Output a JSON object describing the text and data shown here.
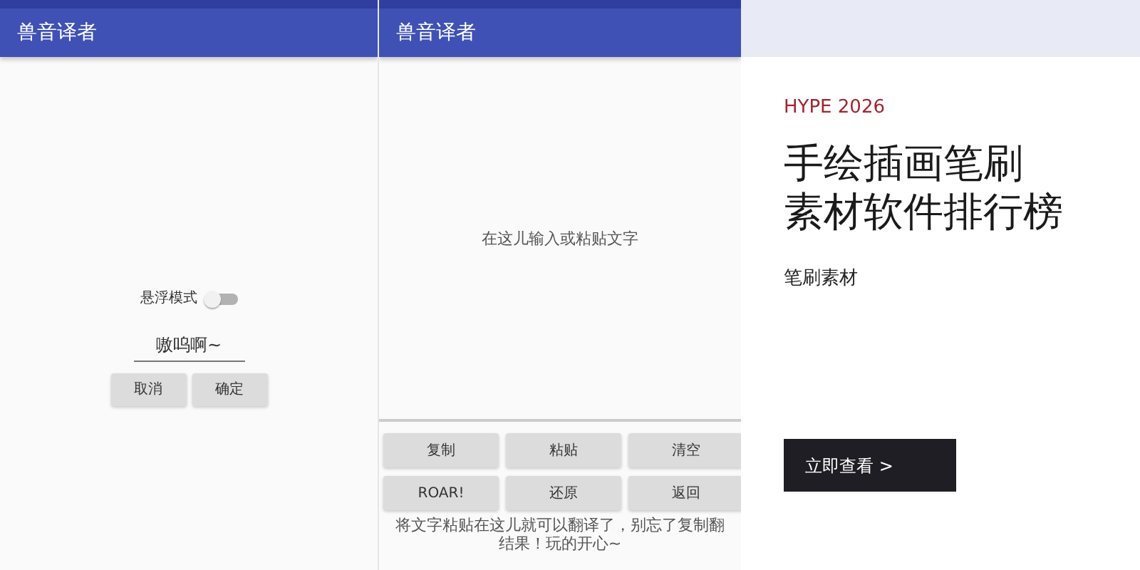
{
  "screens": [
    {
      "app_bar": {
        "title": "兽音译者"
      },
      "float_switch": {
        "label": "悬浮模式",
        "on": false
      },
      "text_field": {
        "value": "嗷呜啊~"
      },
      "buttons": [
        "取消",
        "确定"
      ]
    },
    {
      "app_bar": {
        "title": "兽音译者"
      },
      "input": {
        "placeholder": "在这儿输入或粘贴文字"
      },
      "buttons": [
        "复制",
        "粘贴",
        "清空",
        "ROAR!",
        "还原",
        "返回"
      ],
      "hint": [
        "将文字粘贴在这儿就可以翻译了，别忘了复制翻",
        "结果！玩的开心~"
      ]
    }
  ],
  "ad": {
    "eyebrow": "HYPE 2026",
    "headline": [
      "手绘插画笔刷",
      "素材软件排行榜"
    ],
    "subtitle": "笔刷素材",
    "cta": "立即查看 >"
  }
}
